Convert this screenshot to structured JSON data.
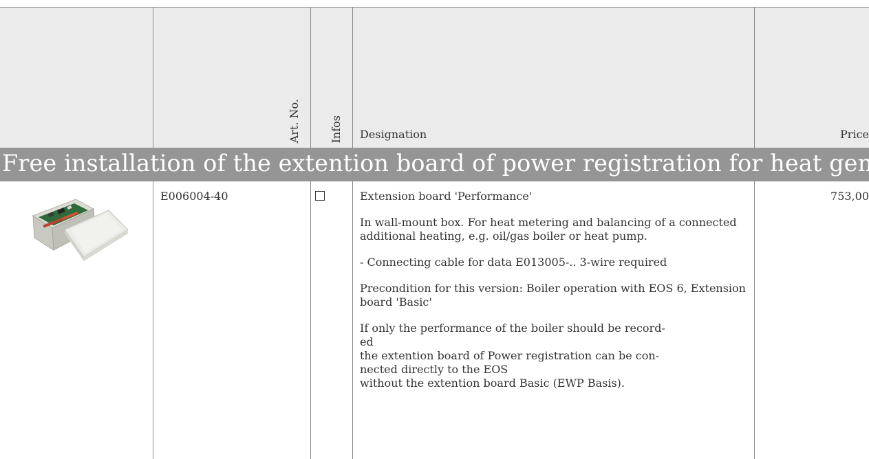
{
  "table": {
    "headers": {
      "art_no": "Art. No.",
      "infos": "Infos",
      "designation": "Designation",
      "price": "Price"
    },
    "section_title": "Free installation of the extention board of power registration for heat generator",
    "rows": [
      {
        "image": "extension-board-wall-mount-box",
        "art_no": "E006004-40",
        "infos_checked": false,
        "title": "Extension board 'Performance'",
        "paragraphs": [
          "In wall-mount box. For heat metering and balancing of a connected additional heating, e.g. oil/gas boiler or heat pump.",
          "- Connecting cable for data E013005-.. 3-wire required",
          "Precondition for this version: Boiler operation with EOS 6, Extension board 'Basic'"
        ],
        "note_lines": [
          "If only the performance of the boiler should be record-",
          "ed",
          "the extention board of Power registration can be con-",
          "nected directly to the EOS",
          "without the extention board Basic (EWP Basis)."
        ],
        "price": "753,00"
      }
    ]
  },
  "colors": {
    "header_bg": "#ebebeb",
    "banner_bg": "#959595",
    "grid_line": "#8c8c8c"
  }
}
